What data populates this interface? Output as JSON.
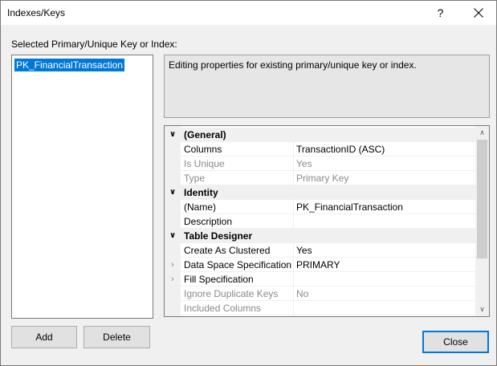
{
  "window": {
    "title": "Indexes/Keys",
    "help_label": "?"
  },
  "section_label": "Selected Primary/Unique Key or Index:",
  "keys": [
    {
      "label": "PK_FinancialTransaction",
      "selected": true
    }
  ],
  "info_text": "Editing properties for existing primary/unique key or index.",
  "properties": {
    "general": {
      "label": "(General)",
      "columns": {
        "name": "Columns",
        "value": "TransactionID (ASC)"
      },
      "is_unique": {
        "name": "Is Unique",
        "value": "Yes"
      },
      "type": {
        "name": "Type",
        "value": "Primary Key"
      }
    },
    "identity": {
      "label": "Identity",
      "name": {
        "name": "(Name)",
        "value": "PK_FinancialTransaction"
      },
      "description": {
        "name": "Description",
        "value": ""
      }
    },
    "table_designer": {
      "label": "Table Designer",
      "create_as_clustered": {
        "name": "Create As Clustered",
        "value": "Yes"
      },
      "data_space": {
        "name": "Data Space Specification",
        "value": "PRIMARY"
      },
      "fill_spec": {
        "name": "Fill Specification",
        "value": ""
      },
      "ignore_dup": {
        "name": "Ignore Duplicate Keys",
        "value": "No"
      },
      "included_columns": {
        "name": "Included Columns",
        "value": ""
      }
    }
  },
  "buttons": {
    "add": "Add",
    "delete": "Delete",
    "close": "Close"
  },
  "colors": {
    "selection": "#0078d7",
    "disabled_text": "#8a8a8a"
  }
}
